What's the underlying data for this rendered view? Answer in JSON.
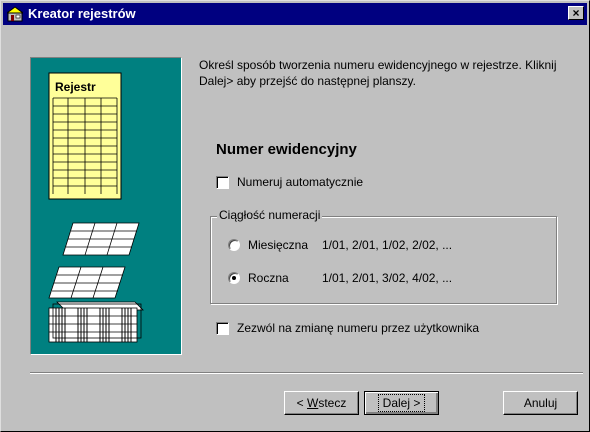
{
  "window": {
    "title": "Kreator rejestrów",
    "icon": "wizard-icon",
    "close_symbol": "×"
  },
  "illustration": {
    "document_title": "Rejestr",
    "background_color": "#008080",
    "document_color": "#ffff99"
  },
  "intro": {
    "text": "Określ sposób tworzenia numeru ewidencyjnego w rejestrze. Kliknij Dalej> aby przejść do następnej planszy."
  },
  "section": {
    "title": "Numer ewidencyjny",
    "auto_number_label": "Numeruj automatycznie",
    "auto_number_checked": false,
    "allow_change_label": "Zezwól na zmianę numeru przez użytkownika",
    "allow_change_checked": false
  },
  "group": {
    "legend": "Ciągłość numeracji",
    "options": [
      {
        "label": "Miesięczna",
        "example": "1/01, 2/01, 1/02, 2/02, ...",
        "selected": false
      },
      {
        "label": "Roczna",
        "example": "1/01, 2/01, 3/02, 4/02, ...",
        "selected": true
      }
    ]
  },
  "buttons": {
    "back_prefix": "< ",
    "back_mnemonic": "W",
    "back_rest": "stecz",
    "next_label": "Dalej >",
    "cancel_label": "Anuluj"
  }
}
